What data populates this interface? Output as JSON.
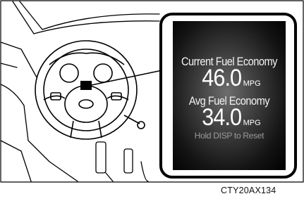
{
  "display": {
    "current_label": "Current Fuel Economy",
    "current_value": "46.0",
    "current_unit": "MPG",
    "avg_label": "Avg Fuel Economy",
    "avg_value": "34.0",
    "avg_unit": "MPG",
    "hint": "Hold DISP to Reset"
  },
  "figure_code": "CTY20AX134",
  "icons": {
    "steering_wheel": "steering-wheel-icon",
    "display_area": "highlight-marker-icon"
  }
}
